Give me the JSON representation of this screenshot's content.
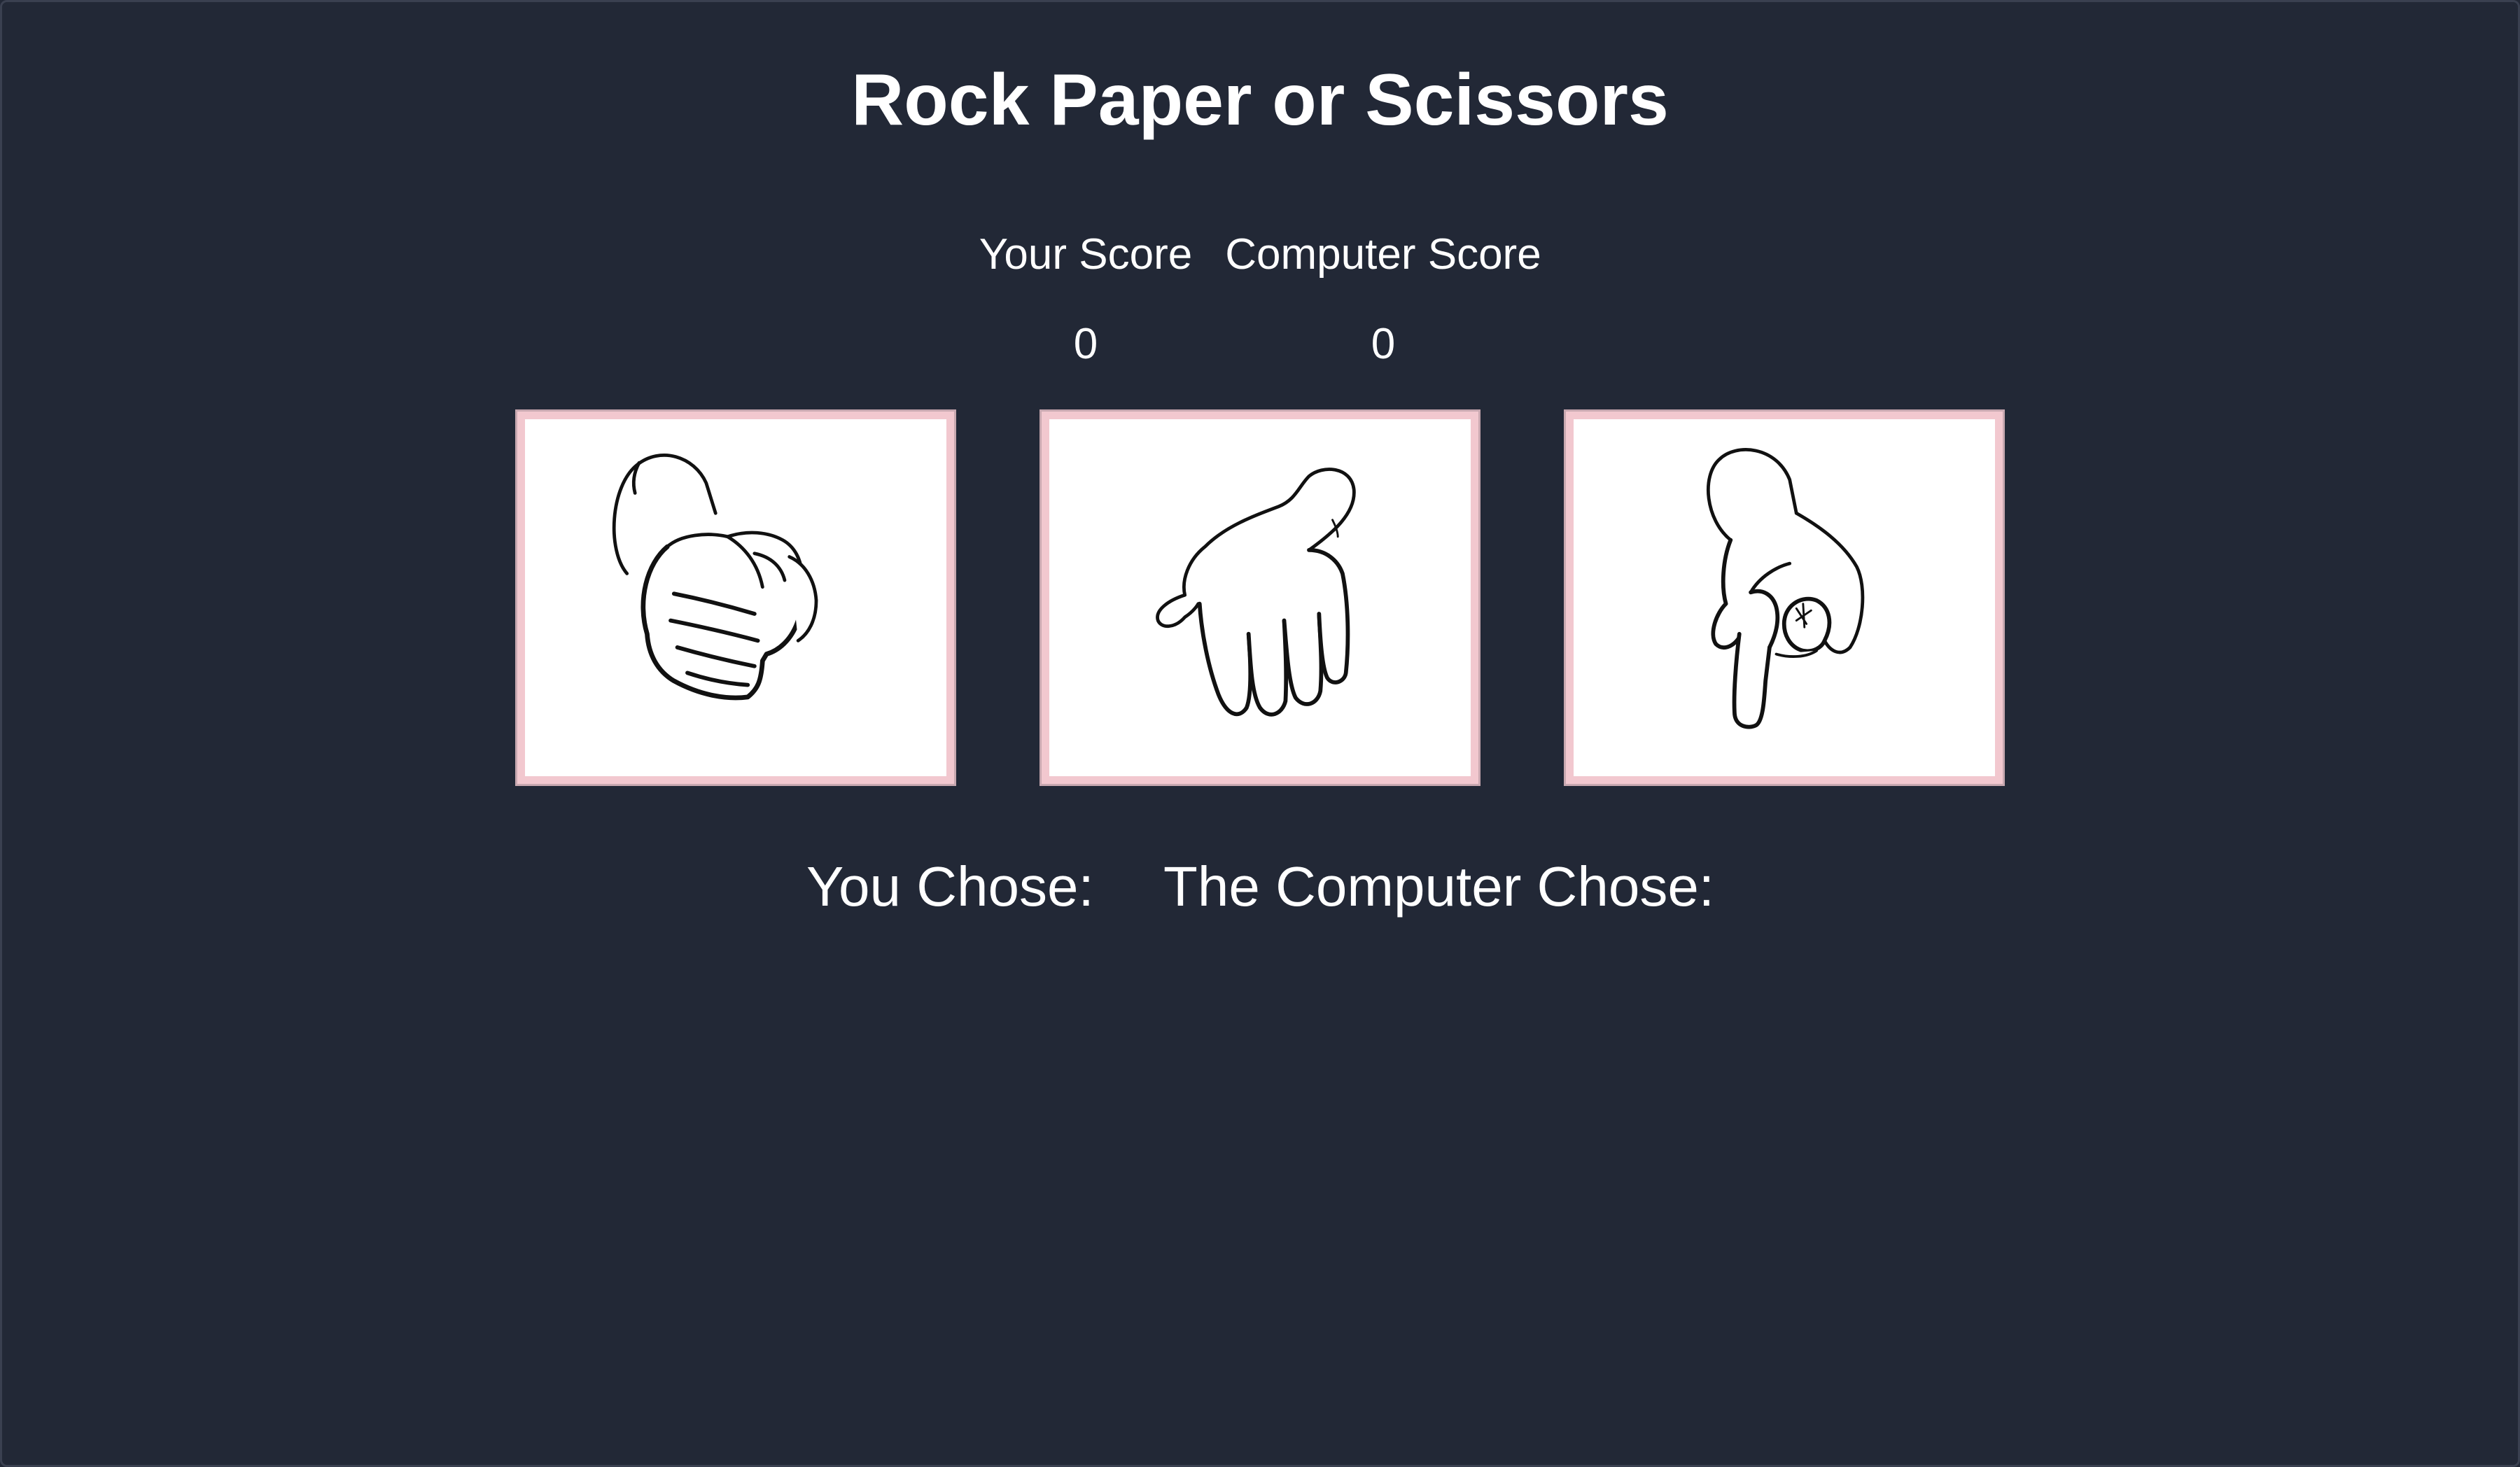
{
  "title": "Rock Paper or Scissors",
  "scores": {
    "your_label": "Your Score",
    "computer_label": "Computer Score",
    "your_value": "0",
    "computer_value": "0"
  },
  "choices": [
    {
      "id": "rock",
      "icon": "rock-hand-icon"
    },
    {
      "id": "paper",
      "icon": "paper-hand-icon"
    },
    {
      "id": "scissors",
      "icon": "scissors-hand-icon"
    }
  ],
  "result": {
    "you_chose": "You Chose:",
    "computer_chose": "The Computer Chose:"
  },
  "colors": {
    "background": "#222836",
    "card_border": "#f2c8cf",
    "text": "#ffffff"
  }
}
